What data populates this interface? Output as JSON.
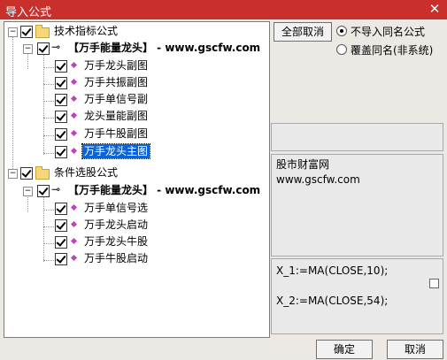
{
  "window": {
    "title": "导入公式",
    "close_icon": "close-icon"
  },
  "tree": {
    "group1": {
      "label": "技术指标公式",
      "sub": {
        "label": "【万手能量龙头】 - www.gscfw.com",
        "items": [
          "万手龙头副图",
          "万手共振副图",
          "万手单信号副",
          "龙头量能副图",
          "万手牛股副图",
          "万手龙头主图"
        ]
      }
    },
    "group2": {
      "label": "条件选股公式",
      "sub": {
        "label": "【万手能量龙头】 - www.gscfw.com",
        "items": [
          "万手单信号选",
          "万手龙头启动",
          "万手龙头牛股",
          "万手牛股启动"
        ]
      }
    },
    "selected_item": "万手龙头主图"
  },
  "options": {
    "cancel_all_label": "全部取消",
    "radio1_label": "不导入同名公式",
    "radio2_label": "覆盖同名(非系统)",
    "selected_radio": "不导入同名公式"
  },
  "info": {
    "line1": "股市财富网",
    "line2": "www.gscfw.com"
  },
  "code": {
    "line1": "X_1:=MA(CLOSE,10);",
    "line2": "X_2:=MA(CLOSE,54);"
  },
  "buttons": {
    "ok": "确定",
    "cancel": "取消"
  }
}
